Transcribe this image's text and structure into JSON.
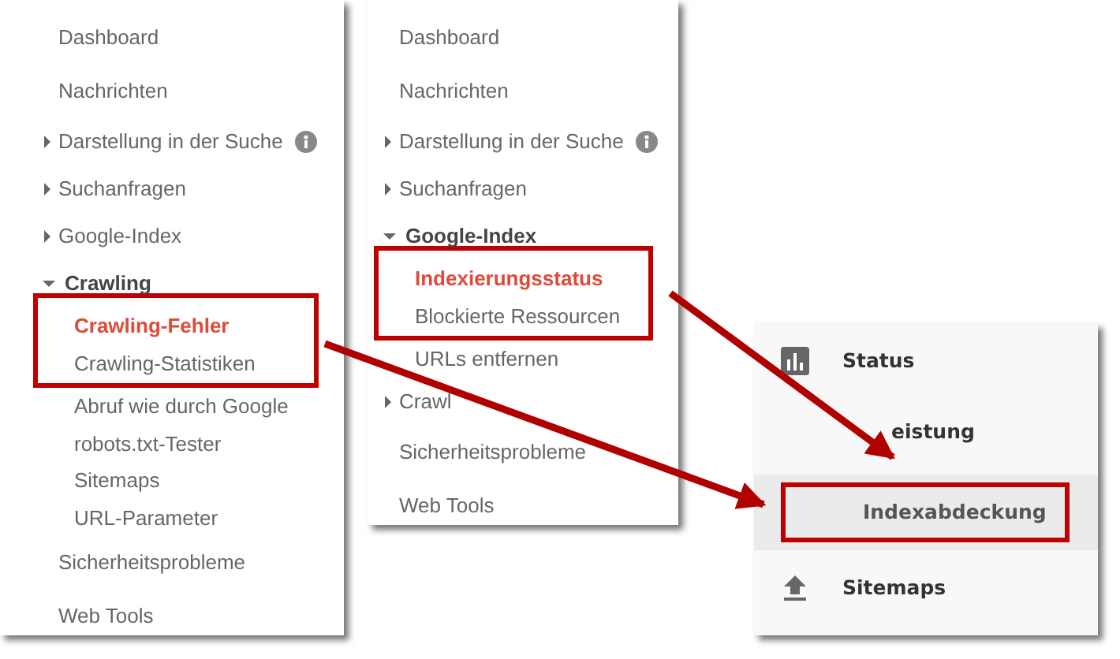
{
  "panels": [
    {
      "kind": "classic",
      "items": [
        {
          "label": "Dashboard",
          "selected": false
        },
        {
          "label": "Nachrichten",
          "selected": false
        },
        {
          "label": "Darstellung in der Suche",
          "selected": false,
          "expanded": false,
          "info": true
        },
        {
          "label": "Suchanfragen",
          "selected": false,
          "expanded": false
        },
        {
          "label": "Google-Index",
          "selected": false,
          "expanded": false
        },
        {
          "label": "Crawling",
          "selected": false,
          "expanded": true,
          "children": [
            {
              "label": "Crawling-Fehler",
              "selected": true,
              "highlighted": true
            },
            {
              "label": "Crawling-Statistiken",
              "selected": false,
              "highlighted": true
            },
            {
              "label": "Abruf wie durch Google",
              "selected": false,
              "highlighted": false
            },
            {
              "label": "robots.txt-Tester",
              "selected": false,
              "highlighted": false
            },
            {
              "label": "Sitemaps",
              "selected": false,
              "highlighted": false
            },
            {
              "label": "URL-Parameter",
              "selected": false,
              "highlighted": false
            }
          ]
        },
        {
          "label": "Sicherheitsprobleme",
          "selected": false
        },
        {
          "label": "Web Tools",
          "selected": false
        }
      ]
    },
    {
      "kind": "classic",
      "items": [
        {
          "label": "Dashboard",
          "selected": false
        },
        {
          "label": "Nachrichten",
          "selected": false
        },
        {
          "label": "Darstellung in der Suche",
          "selected": false,
          "expanded": false,
          "info": true
        },
        {
          "label": "Suchanfragen",
          "selected": false,
          "expanded": false
        },
        {
          "label": "Google-Index",
          "selected": false,
          "expanded": true,
          "children": [
            {
              "label": "Indexierungsstatus",
              "selected": true,
              "highlighted": true
            },
            {
              "label": "Blockierte Ressourcen",
              "selected": false,
              "highlighted": true
            },
            {
              "label": "URLs entfernen",
              "selected": false,
              "highlighted": false
            }
          ]
        },
        {
          "label": "Crawl",
          "selected": false,
          "expanded": false
        },
        {
          "label": "Sicherheitsprobleme",
          "selected": false
        },
        {
          "label": "Web Tools",
          "selected": false
        }
      ]
    },
    {
      "kind": "modern",
      "items": [
        {
          "kind": "chart",
          "label": "Status",
          "selected": false,
          "highlighted": false
        },
        {
          "kind": "sub",
          "label": "eistung",
          "selected": false,
          "highlighted": false
        },
        {
          "kind": "sub",
          "label": "Indexabdeckung",
          "selected": true,
          "highlighted": true
        },
        {
          "kind": "upload",
          "label": "Sitemaps",
          "selected": false,
          "highlighted": false
        }
      ]
    }
  ]
}
